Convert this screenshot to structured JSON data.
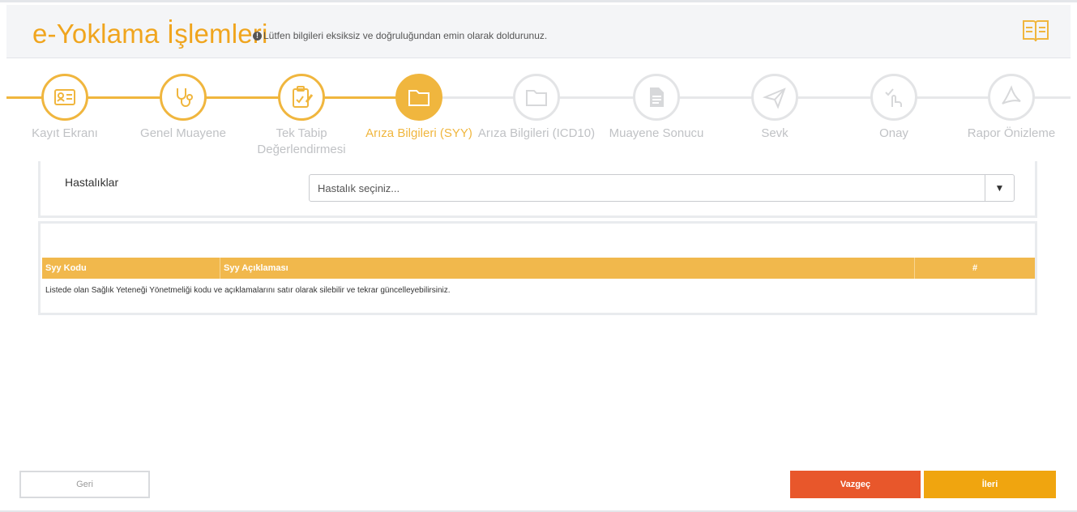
{
  "header": {
    "title": "e-Yoklama İşlemleri",
    "notice_icon": "!",
    "notice": "Lütfen bilgileri eksiksiz ve doğruluğundan emin olarak doldurunuz.",
    "book_icon": "book-icon"
  },
  "steps": [
    {
      "label": "Kayıt Ekranı",
      "icon": "id-card-icon",
      "state": "done"
    },
    {
      "label": "Genel Muayene",
      "icon": "stethoscope-icon",
      "state": "done"
    },
    {
      "label": "Tek Tabip Değerlendirmesi",
      "icon": "clipboard-edit-icon",
      "state": "done"
    },
    {
      "label": "Arıza Bilgileri (SYY)",
      "icon": "folder-icon",
      "state": "active"
    },
    {
      "label": "Arıza Bilgileri (ICD10)",
      "icon": "folder-icon",
      "state": "todo"
    },
    {
      "label": "Muayene Sonucu",
      "icon": "document-icon",
      "state": "todo"
    },
    {
      "label": "Sevk",
      "icon": "paper-plane-icon",
      "state": "todo"
    },
    {
      "label": "Onay",
      "icon": "touch-check-icon",
      "state": "todo"
    },
    {
      "label": "Rapor Önizleme",
      "icon": "pdf-icon",
      "state": "todo"
    }
  ],
  "form": {
    "disease_label": "Hastalıklar",
    "disease_placeholder": "Hastalık seçiniz...",
    "dropdown_arrow": "▼"
  },
  "table": {
    "columns": [
      "Syy Kodu",
      "Syy Açıklaması",
      "#"
    ],
    "rows": [],
    "note": "Listede olan Sağlık Yeteneği Yönetmeliği kodu ve açıklamalarını satır olarak silebilir ve tekrar güncelleyebilirsiniz."
  },
  "buttons": {
    "back": "Geri",
    "cancel": "Vazgeç",
    "next": "İleri"
  },
  "colors": {
    "accent": "#f0b63e",
    "title": "#f0a51e",
    "cancel": "#e8572b",
    "next": "#f0a50f",
    "inactive": "#e3e4e6"
  }
}
